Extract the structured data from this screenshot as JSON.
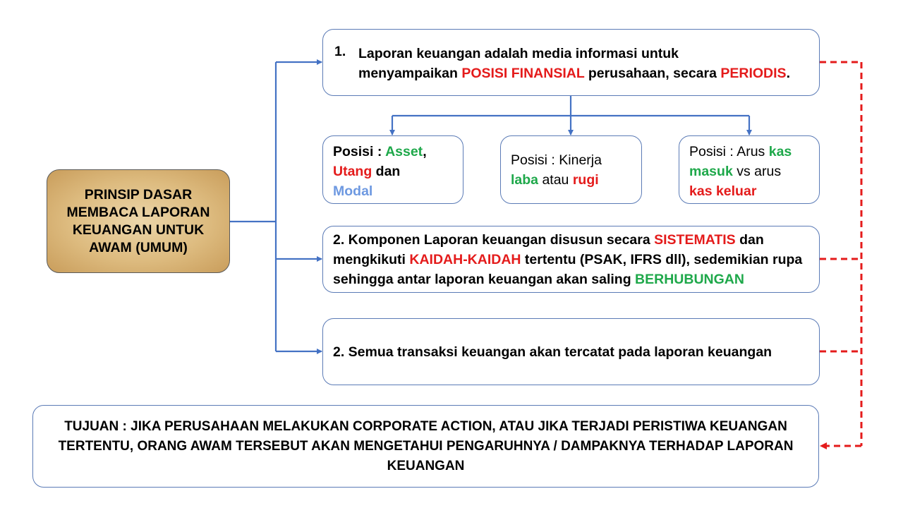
{
  "main": {
    "text": "PRINSIP DASAR MEMBACA LAPORAN KEUANGAN UNTUK AWAM (UMUM)"
  },
  "box1": {
    "number": "1.",
    "line1": "Laporan keuangan adalah media informasi untuk",
    "pre": "menyampaikan ",
    "hl1": "POSISI FINANSIAL",
    "mid": " perusahaan, secara ",
    "hl2": "PERIODIS",
    "end": "."
  },
  "sub1": {
    "label": "Posisi : ",
    "asset": "Asset",
    "comma": ",",
    "utang": "Utang",
    "dan": " dan",
    "modal": "Modal"
  },
  "sub2": {
    "label": "Posisi : Kinerja",
    "laba": "laba",
    "atau": " atau ",
    "rugi": "rugi"
  },
  "sub3": {
    "label": "Posisi : Arus ",
    "kas1": "kas",
    "masuk": "masuk",
    "vs": " vs arus",
    "keluar": "kas keluar"
  },
  "box2": {
    "p1": "2. Komponen Laporan keuangan disusun secara ",
    "hl1": "SISTEMATIS",
    "p2": " dan mengkikuti ",
    "hl2": "KAIDAH-KAIDAH",
    "p3": " tertentu (PSAK, IFRS dll), sedemikian rupa sehingga antar laporan keuangan akan saling ",
    "hl3": "BERHUBUNGAN"
  },
  "box3": {
    "text": "2. Semua transaksi keuangan akan tercatat pada laporan keuangan"
  },
  "tujuan": {
    "text": "TUJUAN : JIKA PERUSAHAAN MELAKUKAN CORPORATE ACTION, ATAU JIKA TERJADI PERISTIWA KEUANGAN TERTENTU, ORANG AWAM TERSEBUT AKAN MENGETAHUI PENGARUHNYA  / DAMPAKNYA TERHADAP LAPORAN KEUANGAN"
  },
  "colors": {
    "connector": "#4472c4",
    "dashed": "#e41b1b",
    "highlight_red": "#e41b1b",
    "highlight_green": "#1ea84a",
    "highlight_blue": "#6e99e1",
    "main_fill": "#ddbb7f"
  }
}
